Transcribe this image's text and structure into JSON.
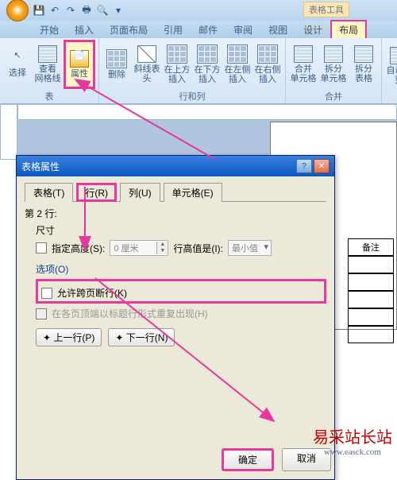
{
  "qat": {
    "contextual_tool_label": "表格工具"
  },
  "ribbon_tabs": {
    "home": "开始",
    "insert": "插入",
    "layout_page": "页面布局",
    "references": "引用",
    "mail": "邮件",
    "review": "审阅",
    "view": "视图",
    "design": "设计",
    "layout_table": "布局"
  },
  "ribbon": {
    "select": "选择",
    "gridlines_view": "查看\n网格线",
    "properties": "属性",
    "group_table": "表",
    "delete": "删除",
    "diag_header": "斜线表头",
    "ins_above": "在上方\n插入",
    "ins_below": "在下方\n插入",
    "ins_left": "在左侧\n插入",
    "ins_right": "在右侧\n插入",
    "group_rows_cols": "行和列",
    "merge": "合并\n单元格",
    "split": "拆分\n单元格",
    "split_table": "拆分\n表格",
    "group_merge": "合并",
    "autofit": "自动调整"
  },
  "dialog": {
    "title": "表格属性",
    "tabs": {
      "table": "表格(T)",
      "row": "行(R)",
      "column": "列(U)",
      "cell": "单元格(E)"
    },
    "row_heading": "第 2 行:",
    "size_label": "尺寸",
    "spec_height": "指定高度(S):",
    "height_value": "0 厘米",
    "height_is_label": "行高值是(I):",
    "height_is_value": "最小值",
    "options_label": "选项(O)",
    "allow_break": "允许跨页断行(K)",
    "repeat_header": "在各页顶端以标题行形式重复出现(H)",
    "prev_row": "上一行(P)",
    "next_row": "下一行(N)",
    "ok": "确定",
    "cancel": "取消"
  },
  "doc_table": {
    "header": "备注"
  },
  "watermark": {
    "cn": "易采站长站",
    "en": "www.easck.com"
  }
}
